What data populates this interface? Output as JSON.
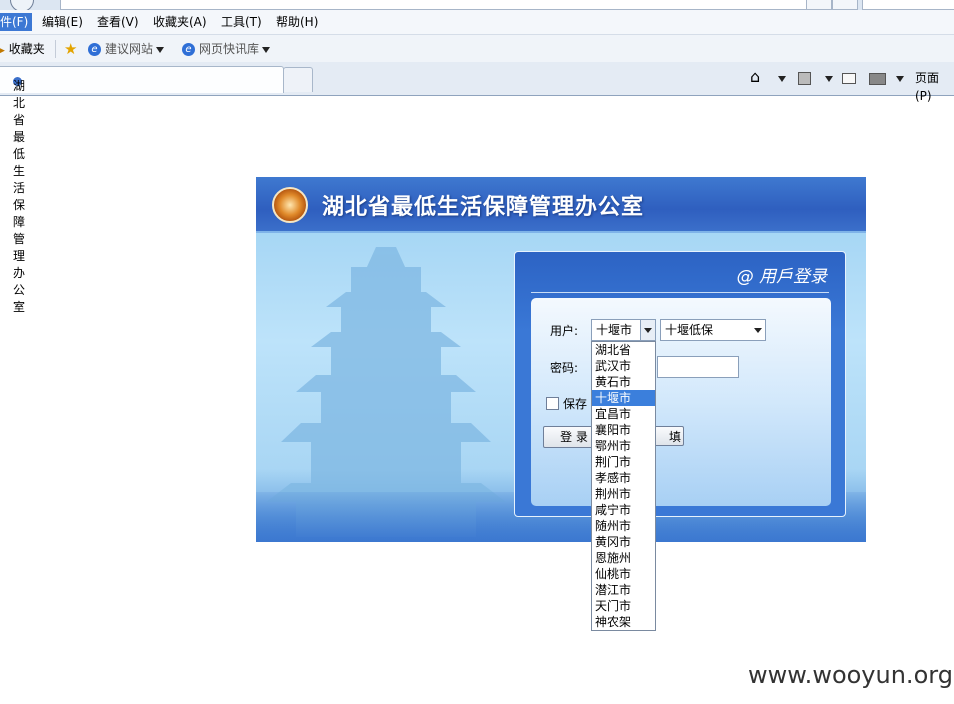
{
  "menu": {
    "items": [
      "件(F)",
      "编辑(E)",
      "查看(V)",
      "收藏夹(A)",
      "工具(T)",
      "帮助(H)"
    ]
  },
  "favorites_bar": {
    "favorites_label": "收藏夹",
    "suggested_sites": "建议网站",
    "web_slice_gallery": "网页快讯库"
  },
  "tab": {
    "title": "湖北省最低生活保障管理办公室"
  },
  "command_bar": {
    "page_label": "页面(P)"
  },
  "page": {
    "banner_title": "湖北省最低生活保障管理办公室",
    "login_title": "@ 用戶登录",
    "user_label": "用户:",
    "password_label": "密码:",
    "save_label": "保存",
    "login_button": "登 录",
    "reset_button": "填",
    "city_select": "十堰市",
    "org_select": "十堰低保"
  },
  "dropdown": {
    "selected_index": 3,
    "options": [
      "湖北省",
      "武汉市",
      "黄石市",
      "十堰市",
      "宜昌市",
      "襄阳市",
      "鄂州市",
      "荆门市",
      "孝感市",
      "荆州市",
      "咸宁市",
      "随州市",
      "黄冈市",
      "恩施州",
      "仙桃市",
      "潜江市",
      "天门市",
      "神农架"
    ]
  },
  "watermark": "www.wooyun.org"
}
